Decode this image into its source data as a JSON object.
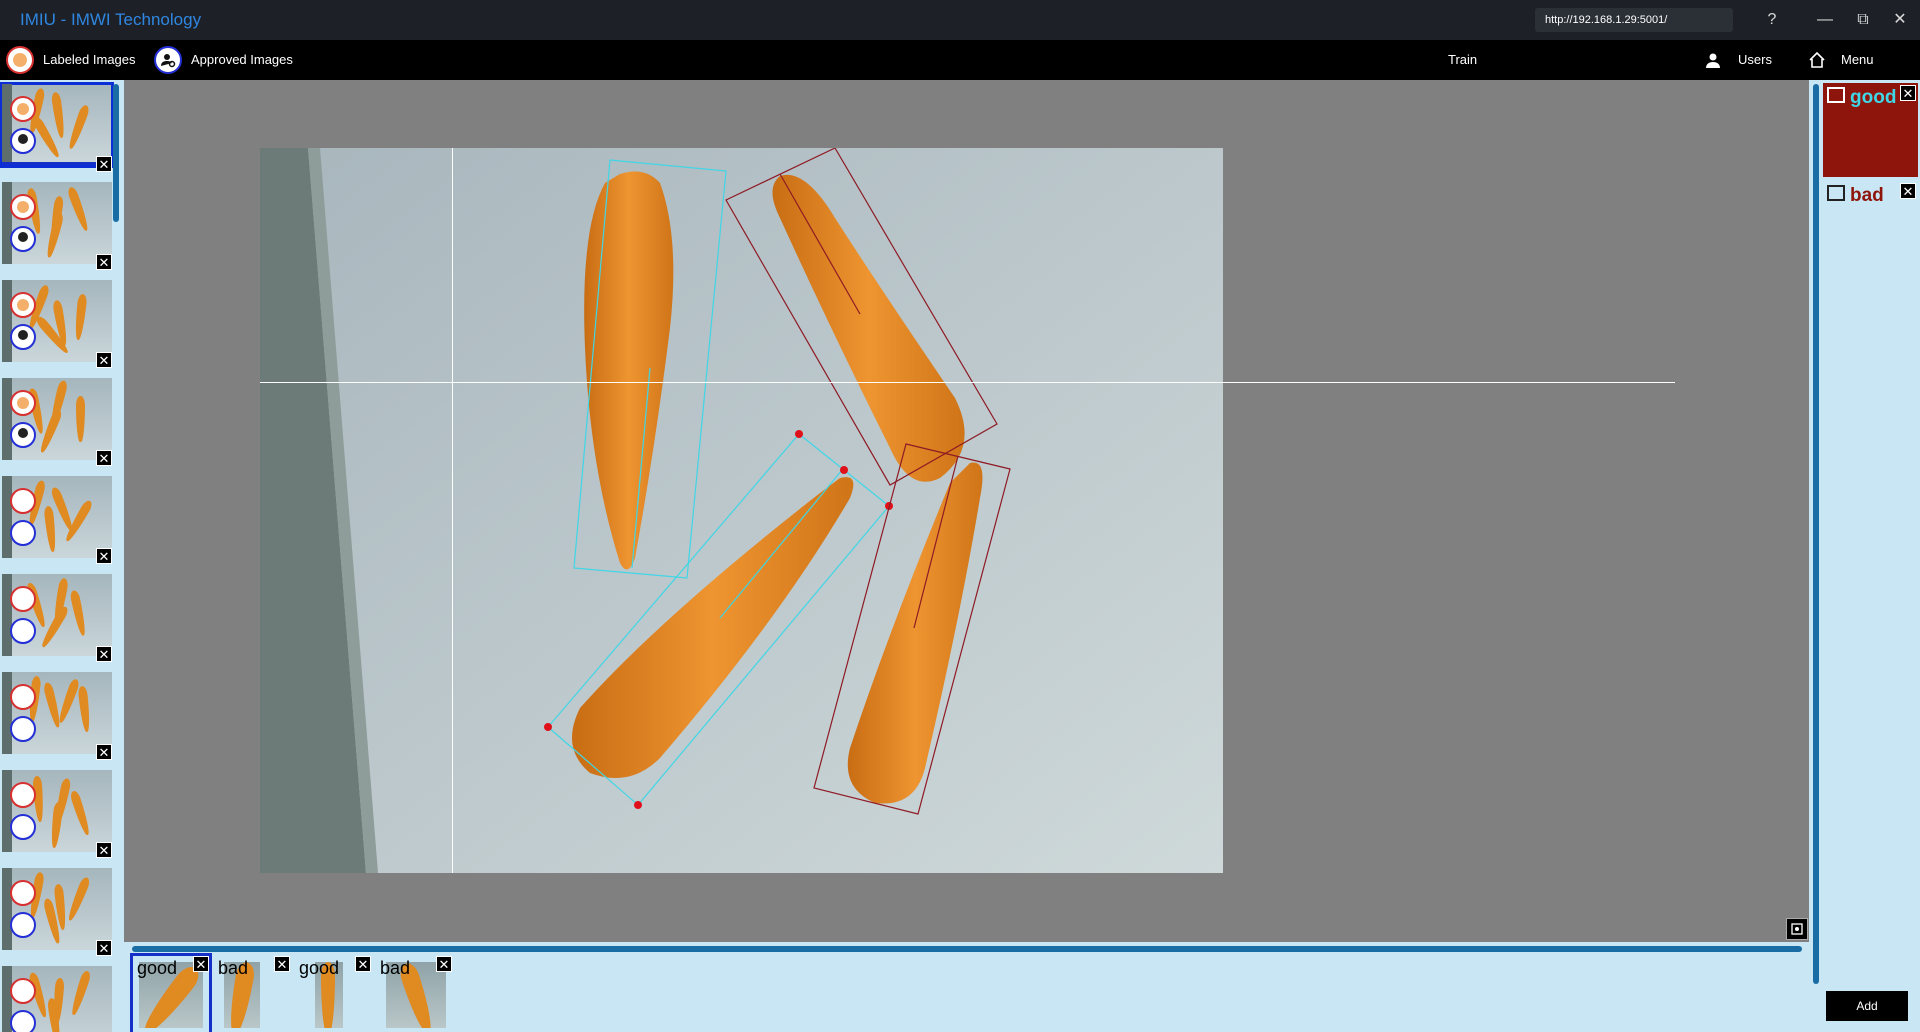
{
  "titlebar": {
    "title": "IMIU - IMWI Technology",
    "url": "http://192.168.1.29:5001/",
    "help": "?",
    "minimize": "—",
    "restore": "⧉",
    "close": "✕"
  },
  "nav": {
    "labeled_images": "Labeled Images",
    "approved_images": "Approved Images",
    "train": "Train",
    "users": "Users",
    "menu": "Menu"
  },
  "thumbnails": [
    {
      "labeled": true,
      "approved": true,
      "selected": true
    },
    {
      "labeled": true,
      "approved": true
    },
    {
      "labeled": true,
      "approved": true
    },
    {
      "labeled": true,
      "approved": true
    },
    {
      "labeled": false,
      "approved": false
    },
    {
      "labeled": false,
      "approved": false
    },
    {
      "labeled": false,
      "approved": false
    },
    {
      "labeled": false,
      "approved": false
    },
    {
      "labeled": false,
      "approved": false
    },
    {
      "labeled": false,
      "approved": false
    }
  ],
  "labels": [
    {
      "name": "good",
      "color": "#3fd6e6",
      "selected": true
    },
    {
      "name": "bad",
      "color": "#8e150b",
      "selected": false
    }
  ],
  "add_button": "Add",
  "crops": [
    {
      "label": "good",
      "selected": true
    },
    {
      "label": "bad"
    },
    {
      "label": "good"
    },
    {
      "label": "bad"
    }
  ],
  "colors": {
    "good_box": "#3fd6e6",
    "bad_box": "#8e1a24",
    "carrot": "#e08a22"
  }
}
